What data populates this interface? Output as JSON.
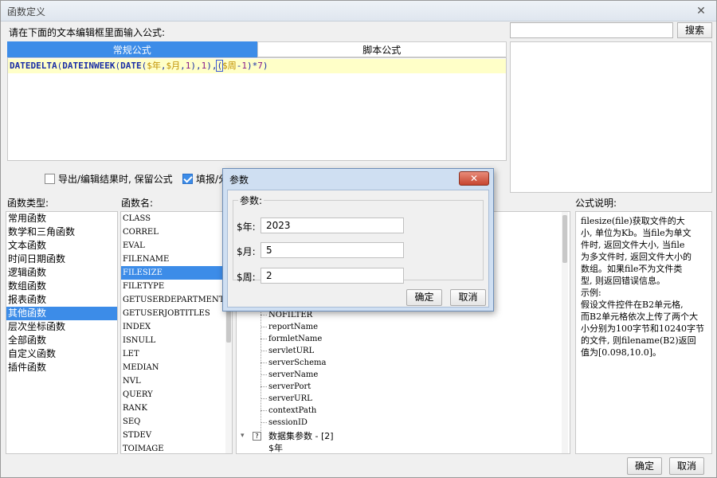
{
  "window": {
    "title": "函数定义",
    "close": "✕"
  },
  "hint": "请在下面的文本编辑框里面输入公式:",
  "tabs": [
    {
      "label": "常规公式"
    },
    {
      "label": "脚本公式"
    }
  ],
  "formula": {
    "parts": [
      "DATEDELTA",
      "(",
      "DATEINWEEK",
      "(",
      "DATE",
      "(",
      "$年",
      ",",
      "$月",
      ",",
      "1",
      ")",
      ",",
      "1",
      ")",
      ",",
      "(",
      "$周",
      "-",
      "1",
      ")",
      "*",
      "7",
      ")"
    ]
  },
  "search": {
    "button": "搜索",
    "value": ""
  },
  "options": {
    "keep_formula": "导出/编辑结果时, 保留公式",
    "fill": "填报/分"
  },
  "labels": {
    "categories": "函数类型:",
    "functions": "函数名:",
    "description": "公式说明:"
  },
  "categories": [
    "常用函数",
    "数学和三角函数",
    "文本函数",
    "时间日期函数",
    "逻辑函数",
    "数组函数",
    "报表函数",
    "其他函数",
    "层次坐标函数",
    "全部函数",
    "自定义函数",
    "插件函数"
  ],
  "selected_category": 7,
  "functions": [
    "CLASS",
    "CORREL",
    "EVAL",
    "FILENAME",
    "FILESIZE",
    "FILETYPE",
    "GETUSERDEPARTMENTS",
    "GETUSERJOBTITLES",
    "INDEX",
    "ISNULL",
    "LET",
    "MEDIAN",
    "NVL",
    "QUERY",
    "RANK",
    "SEQ",
    "STDEV",
    "TOIMAGE"
  ],
  "selected_function": 4,
  "tree": {
    "leaves": [
      "NOFILTER",
      "reportName",
      "formletName",
      "servletURL",
      "serverSchema",
      "serverName",
      "serverPort",
      "serverURL",
      "contextPath",
      "sessionID"
    ],
    "group": "数据集参数 - [2]",
    "group_child": "$年"
  },
  "description": [
    "filesize(file)获取文件的大",
    "小, 单位为Kb。当file为单文",
    "件时, 返回文件大小, 当file",
    "为多文件时, 返回文件大小的",
    "数组。如果file不为文件类",
    "型, 则返回错误信息。",
    "示例:",
    "假设文件控件在B2单元格,",
    "而B2单元格依次上传了两个大",
    "小分别为100字节和10240字节",
    "的文件, 则filename(B2)返回",
    "值为[0.098,10.0]。"
  ],
  "buttons": {
    "ok": "确定",
    "cancel": "取消"
  },
  "dialog": {
    "title": "参数",
    "group": "参数:",
    "params": [
      {
        "label": "$年:",
        "value": "2023"
      },
      {
        "label": "$月:",
        "value": "5"
      },
      {
        "label": "$周:",
        "value": "2"
      }
    ],
    "ok": "确定",
    "cancel": "取消"
  },
  "colors": {
    "accent": "#3c8ce8",
    "formula_bg": "#ffffc8"
  }
}
